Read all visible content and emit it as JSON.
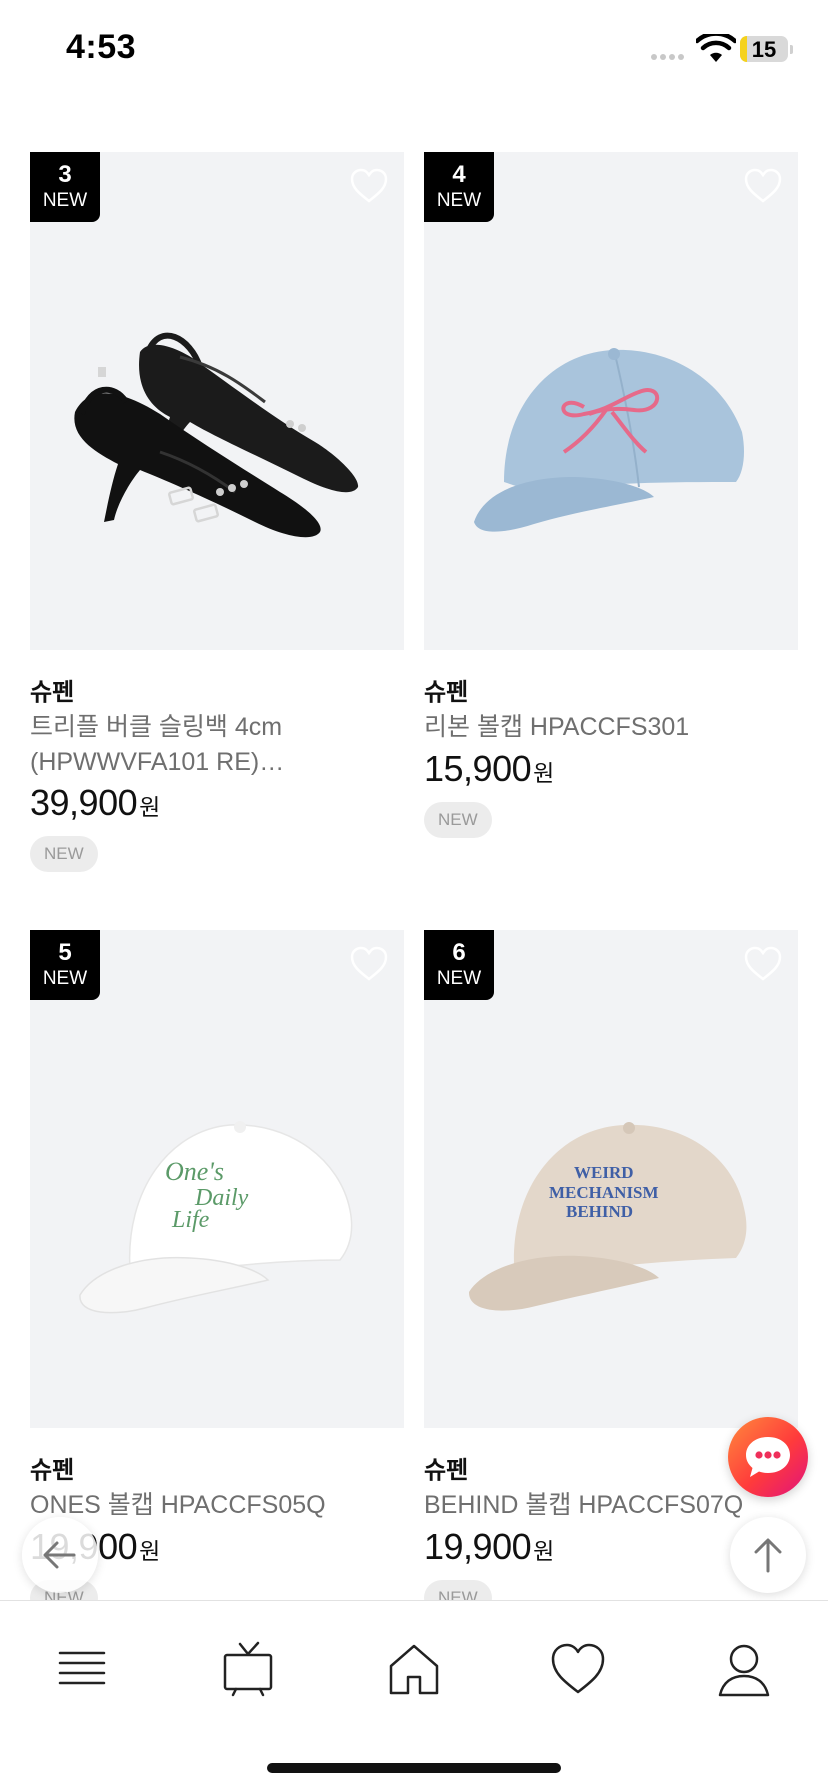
{
  "status_bar": {
    "time": "4:53",
    "battery": "15",
    "battery_level": 0.15
  },
  "products": [
    {
      "rank": "3",
      "rank_tag": "NEW",
      "brand": "슈펜",
      "name": "트리플 버클 슬링백 4cm (HPWWVFA101 RE)…",
      "price": "39,900",
      "currency": "원",
      "tag": "NEW",
      "image": "black-slingback-heels"
    },
    {
      "rank": "4",
      "rank_tag": "NEW",
      "brand": "슈펜",
      "name": "리본 볼캡 HPACCFS301",
      "price": "15,900",
      "currency": "원",
      "tag": "NEW",
      "image": "light-blue-cap-pink-ribbon"
    },
    {
      "rank": "5",
      "rank_tag": "NEW",
      "brand": "슈펜",
      "name": "ONES 볼캡 HPACCFS05Q",
      "price": "19,900",
      "currency": "원",
      "tag": "NEW",
      "image": "white-cap-ones-daily-life",
      "cap_text": [
        "One's",
        "Daily",
        "Life"
      ]
    },
    {
      "rank": "6",
      "rank_tag": "NEW",
      "brand": "슈펜",
      "name": "BEHIND 볼캡 HPACCFS07Q",
      "price": "19,900",
      "currency": "원",
      "tag": "NEW",
      "image": "beige-cap-weird-mechanism-behind",
      "cap_text": [
        "WEIRD",
        "MECHANISM",
        "BEHIND"
      ]
    }
  ],
  "floating": {
    "back": "arrow-left-icon",
    "top": "arrow-up-icon",
    "chat": "chat-bubble-icon"
  },
  "bottom_nav": [
    "menu-icon",
    "tv-icon",
    "home-icon",
    "heart-icon",
    "profile-icon"
  ],
  "colors": {
    "badge_bg": "#000000",
    "image_bg": "#f2f3f5",
    "chat_gradient_start": "#ff8a3d",
    "chat_gradient_end": "#e0127e",
    "battery_fill": "#f5d21c"
  }
}
